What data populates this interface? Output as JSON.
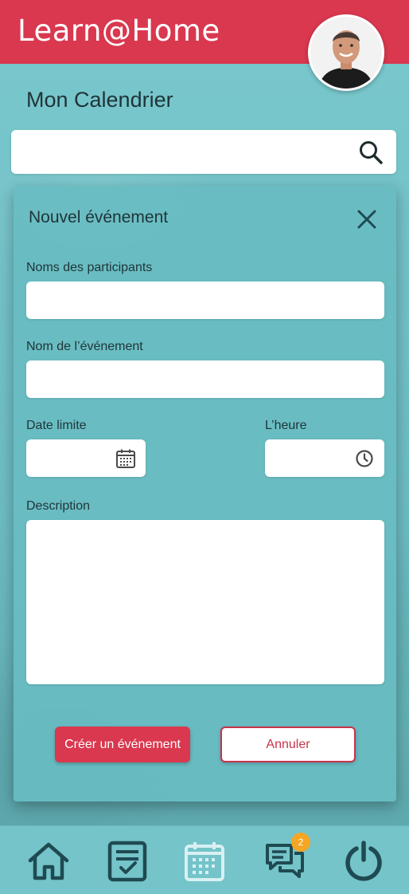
{
  "header": {
    "app_title": "Learn@Home"
  },
  "page": {
    "title": "Mon Calendrier"
  },
  "search": {
    "value": "",
    "placeholder": ""
  },
  "modal": {
    "title": "Nouvel événement",
    "fields": {
      "participants": {
        "label": "Noms des participants",
        "value": ""
      },
      "event_name": {
        "label": "Nom de l’événement",
        "value": ""
      },
      "deadline": {
        "label": "Date limite",
        "value": ""
      },
      "time": {
        "label": "L’heure",
        "value": ""
      },
      "description": {
        "label": "Description",
        "value": ""
      }
    },
    "create_label": "Créer un événement",
    "cancel_label": "Annuler"
  },
  "nav": {
    "items": [
      {
        "icon": "home-icon"
      },
      {
        "icon": "tasks-icon"
      },
      {
        "icon": "calendar-icon",
        "active": true
      },
      {
        "icon": "chat-icon",
        "badge": "2"
      },
      {
        "icon": "power-icon"
      }
    ]
  },
  "colors": {
    "brand": "#d9384f",
    "background": "#74c4c9",
    "icon_dark": "#1f4a52",
    "badge": "#f5a623"
  }
}
